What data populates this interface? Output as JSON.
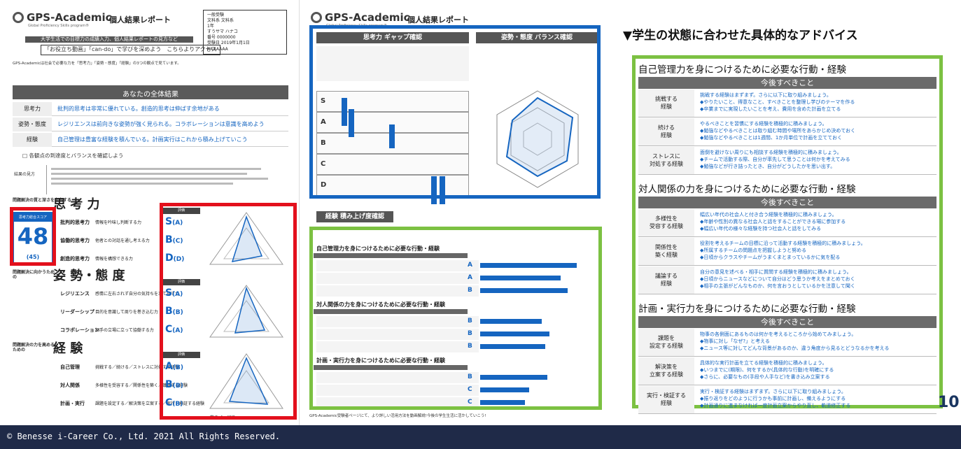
{
  "brand": {
    "name": "GPS-Academic",
    "tagline": "Global Proficiency Skills program®",
    "report_title": "個人結果レポート"
  },
  "page1": {
    "info_lines": [
      "一般受験",
      "文科系 文科系",
      "1年",
      "すうサマ ハナコ",
      "番号 0000000",
      "受験日 2019年1月1日",
      "AAAAAAA"
    ],
    "promo_band": "大学生活での目標力の成績入力、個人結果レポートの見方など",
    "promo_text": "「お役立ち動画」「can-do」で学びを深めよう　こちらよりアクセス",
    "intro": "GPS-Academicは社会で必要な力を「思考力」「姿勢・態度」「経験」の3つの観点で見ています。",
    "overall_head": "あなたの全体結果",
    "overall_rows": [
      {
        "k": "思考力",
        "v": "批判的思考は非常に優れている。創造的思考は伸ばす余地がある"
      },
      {
        "k": "姿勢・態度",
        "v": "レジリエンスは前向きな姿勢が強く見られる。コラボレーションは意識を高めよう"
      },
      {
        "k": "経験",
        "v": "自己管理は豊富な経験を積んでいる。計画実行はこれから積み上げていこう"
      }
    ],
    "check_note": "□ 各観点の到達度とバランスを確認しよう",
    "viewpoint_label": "結果の見方",
    "shikou": {
      "kicker": "問題解決の質と深さを左右する",
      "title": "思 考 力"
    },
    "score_label": "思考力総合スコア",
    "score": "48",
    "score_sub": "(45)",
    "shikou_items": [
      {
        "k": "批判的思考力",
        "d": "情報を吟味し判断する力",
        "g": "S",
        "s": "(A)"
      },
      {
        "k": "協働的思考力",
        "d": "他者との対話を通し考える力",
        "g": "B",
        "s": "(C)"
      },
      {
        "k": "創造的思考力",
        "d": "情報を構想できる力",
        "g": "D",
        "s": "(D)"
      }
    ],
    "shisei": {
      "kicker": "問題解決に向かうための",
      "title": "姿 勢・態 度"
    },
    "shisei_items": [
      {
        "k": "レジリエンス",
        "d": "感情に左右されず自分の気持ちを立て直す力",
        "g": "S",
        "s": "(A)"
      },
      {
        "k": "リーダーシップ",
        "d": "目的を意識して周りを巻き込む力",
        "g": "B",
        "s": "(B)"
      },
      {
        "k": "コラボレーション",
        "d": "相手の立場に立って協働する力",
        "g": "C",
        "s": "(A)"
      }
    ],
    "keiken": {
      "kicker": "問題解決の力を高めるための",
      "title": "経 験"
    },
    "keiken_items": [
      {
        "k": "自己管理",
        "d": "挑戦する／続ける／ストレスに対処する経験",
        "g": "A",
        "s": "(B)"
      },
      {
        "k": "対人関係",
        "d": "多様性を受容する／関係性を築く／議論する経験",
        "g": "B",
        "s": "(B)"
      },
      {
        "k": "計画・実行",
        "d": "課題を設定する／解決策を立案する／実行・検証する経験",
        "g": "C",
        "s": "(B)"
      }
    ],
    "grade_head": "評価",
    "next_page": "次のページで"
  },
  "page2": {
    "gap_head": "思考力 ギャップ確認",
    "balance_head": "姿勢・態度 バランス確認",
    "progress_head": "経験 積み上げ度確認",
    "grade_levels": [
      "S",
      "A",
      "B",
      "C",
      "D"
    ],
    "sec_titles": [
      "自己管理力を身につけるために必要な行動・経験",
      "対人関係の力を身につけるために必要な行動・経験",
      "計画・実行力を身につけるために必要な行動・経験"
    ],
    "sec_grades": [
      [
        "A",
        "A",
        "B"
      ],
      [
        "B",
        "B",
        "B"
      ],
      [
        "B",
        "C",
        "C"
      ]
    ],
    "bar_values": [
      0.86,
      0.72,
      0.78,
      0.55,
      0.62,
      0.58,
      0.6,
      0.44,
      0.4
    ],
    "bottom_note": "GPS-Academic受験者ページにて、より詳しい活用方法を動画解説!今後の学生生活に活かしていこう!"
  },
  "advice": {
    "heading": "▼学生の状態に合わせた具体的なアドバイス",
    "col_label": "今後すべきこと",
    "sections": [
      {
        "title": "自己管理力を身につけるために必要な行動・経験",
        "rows": [
          {
            "k": "挑戦する\n経験",
            "v": [
              "挑戦する経験はまずまず。さらに以下に取り組みましょう。",
              "◆やりたいこと、得意なこと、すべきことを整理し学びのテーマを作る",
              "◆卒業までに実現したいことを考え、費用を含めた計画を立てる"
            ]
          },
          {
            "k": "続ける\n経験",
            "v": [
              "やるべきことを習慣にする経験を積極的に積みましょう。",
              "◆勉強などやるべきことは取り組む時間や場所をあらかじめ決めておく",
              "◆勉強などやるべきことは1週間、1か月単位で計画を立てておく"
            ]
          },
          {
            "k": "ストレスに\n対処する経験",
            "v": [
              "面倒を避けない周りにも相談する経験を積極的に積みましょう。",
              "◆チームで活動する際、自分が率先して思うことは何かを考えてみる",
              "◆勉強などが行き詰ったとき、自分がどうしたかを思い出す。"
            ]
          }
        ]
      },
      {
        "title": "対人関係の力を身につけるために必要な行動・経験",
        "rows": [
          {
            "k": "多様性を\n受容する経験",
            "v": [
              "幅広い年代の社会人と付き合う経験を積極的に積みましょう。",
              "◆年齢や性別の異なる社会人と話をすることができる場に参加する",
              "◆幅広い年代の様々な経験を持つ社会人と話をしてみる"
            ]
          },
          {
            "k": "関係性を\n築く経験",
            "v": [
              "役割を考えるチームの目標に沿って活動する経験を積極的に積みましょう。",
              "◆所属するチームの問題点を把握しようと努める",
              "◆日頃からクラスやチームがうまくまとまっているかに気を配る"
            ]
          },
          {
            "k": "議論する\n経験",
            "v": [
              "自分の意見を述べる・相手に質問する経験を積極的に積みましょう。",
              "◆日頃からニュースなどについて自分はどう思うか考えをまとめておく",
              "◆相手の主張がどんなものか、何を言おうとしているかを注意して聞く"
            ]
          }
        ]
      },
      {
        "title": "計画・実行力を身につけるために必要な行動・経験",
        "rows": [
          {
            "k": "課題を\n設定する経験",
            "v": [
              "物事の各側面にあるものは何かを考えるところから始めてみましょう。",
              "◆物事に対し「なぜ?」と考える",
              "◆ニュース等に対してどんな背景があるのか、違う角度から見るとどうなるかを考える"
            ]
          },
          {
            "k": "解決策を\n立案する経験",
            "v": [
              "具体的な実行計画を立てる経験を積極的に積みましょう。",
              "◆いつまでに(期限)、何をするか(具体的な行動)を明確にする",
              "◆さらに、必要なもの(手段や人手など)を書き込み立案する"
            ]
          },
          {
            "k": "実行・検証する\n経験",
            "v": [
              "実行・検証する経験はまずまず。さらに以下に取り組みましょう。",
              "◆振り返りをどのように行うかも事前に計画し、備えるようにする",
              "◆計画通りに進まなければ一度計画立案からやり直し、軌道修正する"
            ]
          }
        ]
      }
    ]
  },
  "page_number": "10",
  "footer": {
    "copyright": "© Benesse i-Career Co., Ltd. 2021 All Rights Reserved."
  }
}
